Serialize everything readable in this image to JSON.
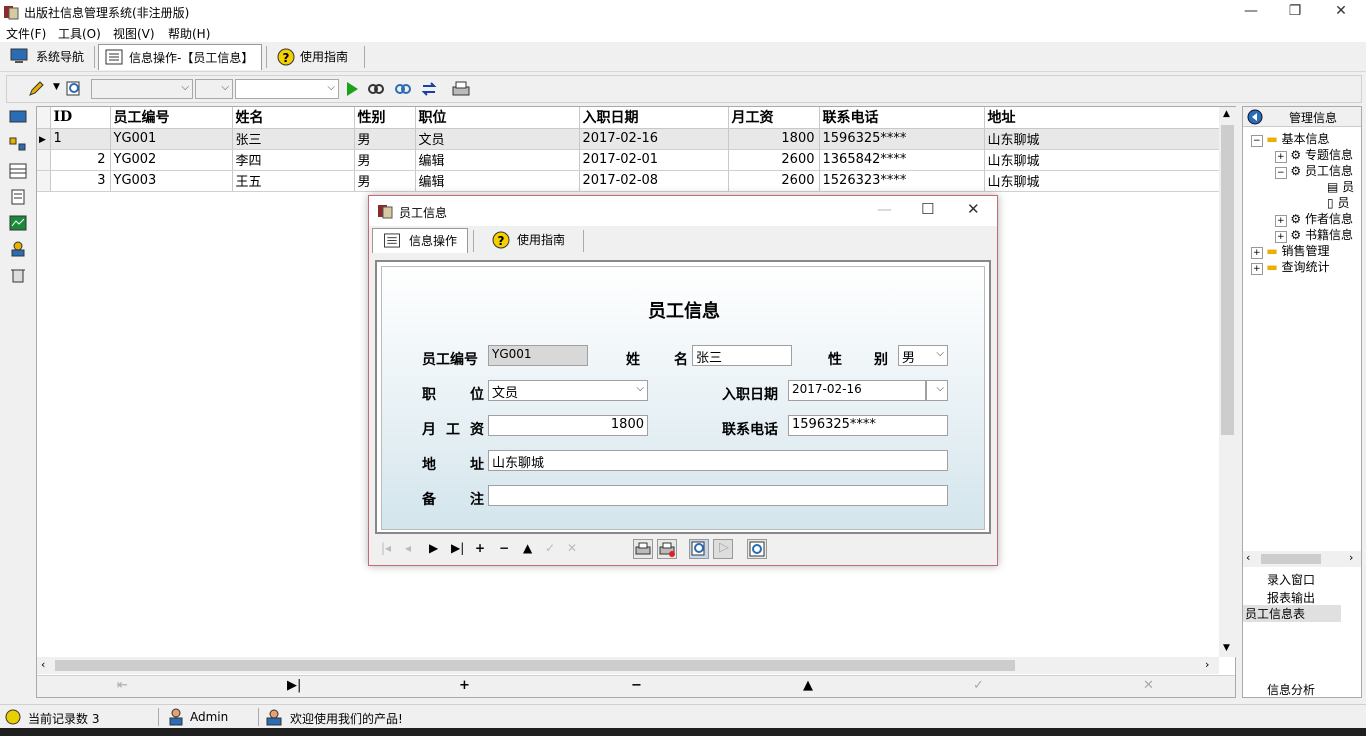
{
  "window": {
    "title": "出版社信息管理系统(非注册版)",
    "minimize": "—",
    "restore": "❐",
    "close": "✕"
  },
  "menu": [
    "文件(F)",
    "工具(O)",
    "视图(V)",
    "帮助(H)"
  ],
  "tabs": {
    "nav": "系统导航",
    "info": "信息操作-【员工信息】",
    "guide": "使用指南"
  },
  "grid": {
    "columns": [
      "ID",
      "员工编号",
      "姓名",
      "性别",
      "职位",
      "入职日期",
      "月工资",
      "联系电话",
      "地址"
    ],
    "rows": [
      {
        "id": "1",
        "code": "YG001",
        "name": "张三",
        "sex": "男",
        "job": "文员",
        "date": "2017-02-16",
        "salary": "1800",
        "phone": "1596325****",
        "addr": "山东聊城"
      },
      {
        "id": "2",
        "code": "YG002",
        "name": "李四",
        "sex": "男",
        "job": "编辑",
        "date": "2017-02-01",
        "salary": "2600",
        "phone": "1365842****",
        "addr": "山东聊城"
      },
      {
        "id": "3",
        "code": "YG003",
        "name": "王五",
        "sex": "男",
        "job": "编辑",
        "date": "2017-02-08",
        "salary": "2600",
        "phone": "1526323****",
        "addr": "山东聊城"
      }
    ]
  },
  "nav": {
    "first": "⇤",
    "last": "▶|",
    "add": "+",
    "delete": "−",
    "up": "▲",
    "check": "✓",
    "cancel": "✕"
  },
  "right_pane": {
    "header": "管理信息",
    "tree": [
      "基本信息",
      "专题信息",
      "员工信息",
      "员",
      "员",
      "作者信息",
      "书籍信息",
      "销售管理",
      "查询统计"
    ],
    "list": [
      "录入窗口",
      "报表输出",
      "员工信息表"
    ],
    "footer": "信息分析"
  },
  "status": {
    "count": "当前记录数 3",
    "user": "Admin",
    "welcome": "欢迎使用我们的产品!"
  },
  "dialog": {
    "title": "员工信息",
    "tab_ops": "信息操作",
    "tab_guide": "使用指南",
    "form_title": "员工信息",
    "labels": {
      "code": "员工编号",
      "name_a": "姓",
      "name_b": "名",
      "sex_a": "性",
      "sex_b": "别",
      "job_a": "职",
      "job_b": "位",
      "date": "入职日期",
      "salary_a": "月",
      "salary_b": "工",
      "salary_c": "资",
      "phone": "联系电话",
      "addr_a": "地",
      "addr_b": "址",
      "note_a": "备",
      "note_b": "注"
    },
    "values": {
      "code": "YG001",
      "name": "张三",
      "sex": "男",
      "job": "文员",
      "date": "2017-02-16",
      "salary": "1800",
      "phone": "1596325****",
      "addr": "山东聊城",
      "note": ""
    }
  },
  "colors": {
    "accent": "#c46b7a",
    "selected_row": "#e8e8e8"
  }
}
